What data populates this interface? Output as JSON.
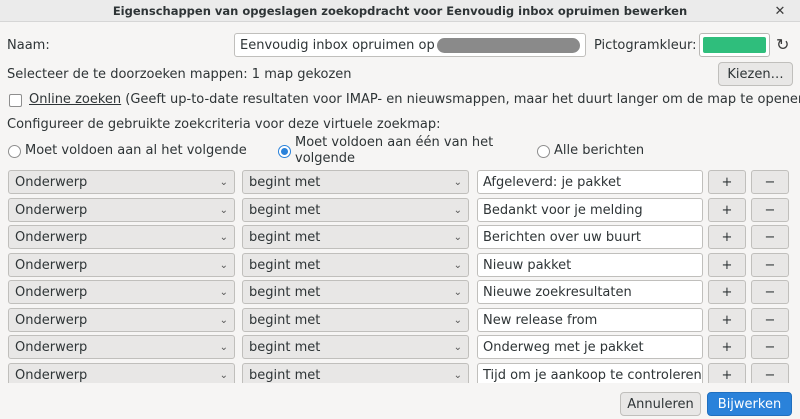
{
  "window": {
    "title": "Eigenschappen van opgeslagen zoekopdracht voor Eenvoudig inbox opruimen bewerken",
    "close_glyph": "✕"
  },
  "name": {
    "label": "Naam:",
    "value": "Eenvoudig inbox opruimen op"
  },
  "icon_color": {
    "label": "Pictogramkleur:",
    "color": "#2fbe7c",
    "reset_glyph": "↻"
  },
  "folders": {
    "label": "Selecteer de te doorzoeken mappen:",
    "count_text": "1 map gekozen",
    "choose_button": "Kiezen…"
  },
  "online": {
    "label": "Online zoeken",
    "description": " (Geeft up-to-date resultaten voor IMAP- en nieuwsmappen, maar het duurt langer om de map te openen)"
  },
  "criteria": {
    "heading": "Configureer de gebruikte zoekcriteria voor deze virtuele zoekmap:",
    "match_all": "Moet voldoen aan al het volgende",
    "match_any_line1": "Moet voldoen aan één van het",
    "match_any_line2": "volgende",
    "match_all_messages": "Alle berichten"
  },
  "rules": [
    {
      "field": "Onderwerp",
      "operator": "begint met",
      "value": "Afgeleverd: je pakket"
    },
    {
      "field": "Onderwerp",
      "operator": "begint met",
      "value": "Bedankt voor je melding"
    },
    {
      "field": "Onderwerp",
      "operator": "begint met",
      "value": "Berichten over uw buurt"
    },
    {
      "field": "Onderwerp",
      "operator": "begint met",
      "value": "Nieuw pakket"
    },
    {
      "field": "Onderwerp",
      "operator": "begint met",
      "value": "Nieuwe zoekresultaten"
    },
    {
      "field": "Onderwerp",
      "operator": "begint met",
      "value": "New release from"
    },
    {
      "field": "Onderwerp",
      "operator": "begint met",
      "value": "Onderweg met je pakket"
    },
    {
      "field": "Onderwerp",
      "operator": "begint met",
      "value": "Tijd om je aankoop te controleren"
    }
  ],
  "rule_buttons": {
    "add": "+",
    "remove": "−",
    "chevron": "⌄"
  },
  "footer": {
    "cancel": "Annuleren",
    "update": "Bijwerken"
  }
}
